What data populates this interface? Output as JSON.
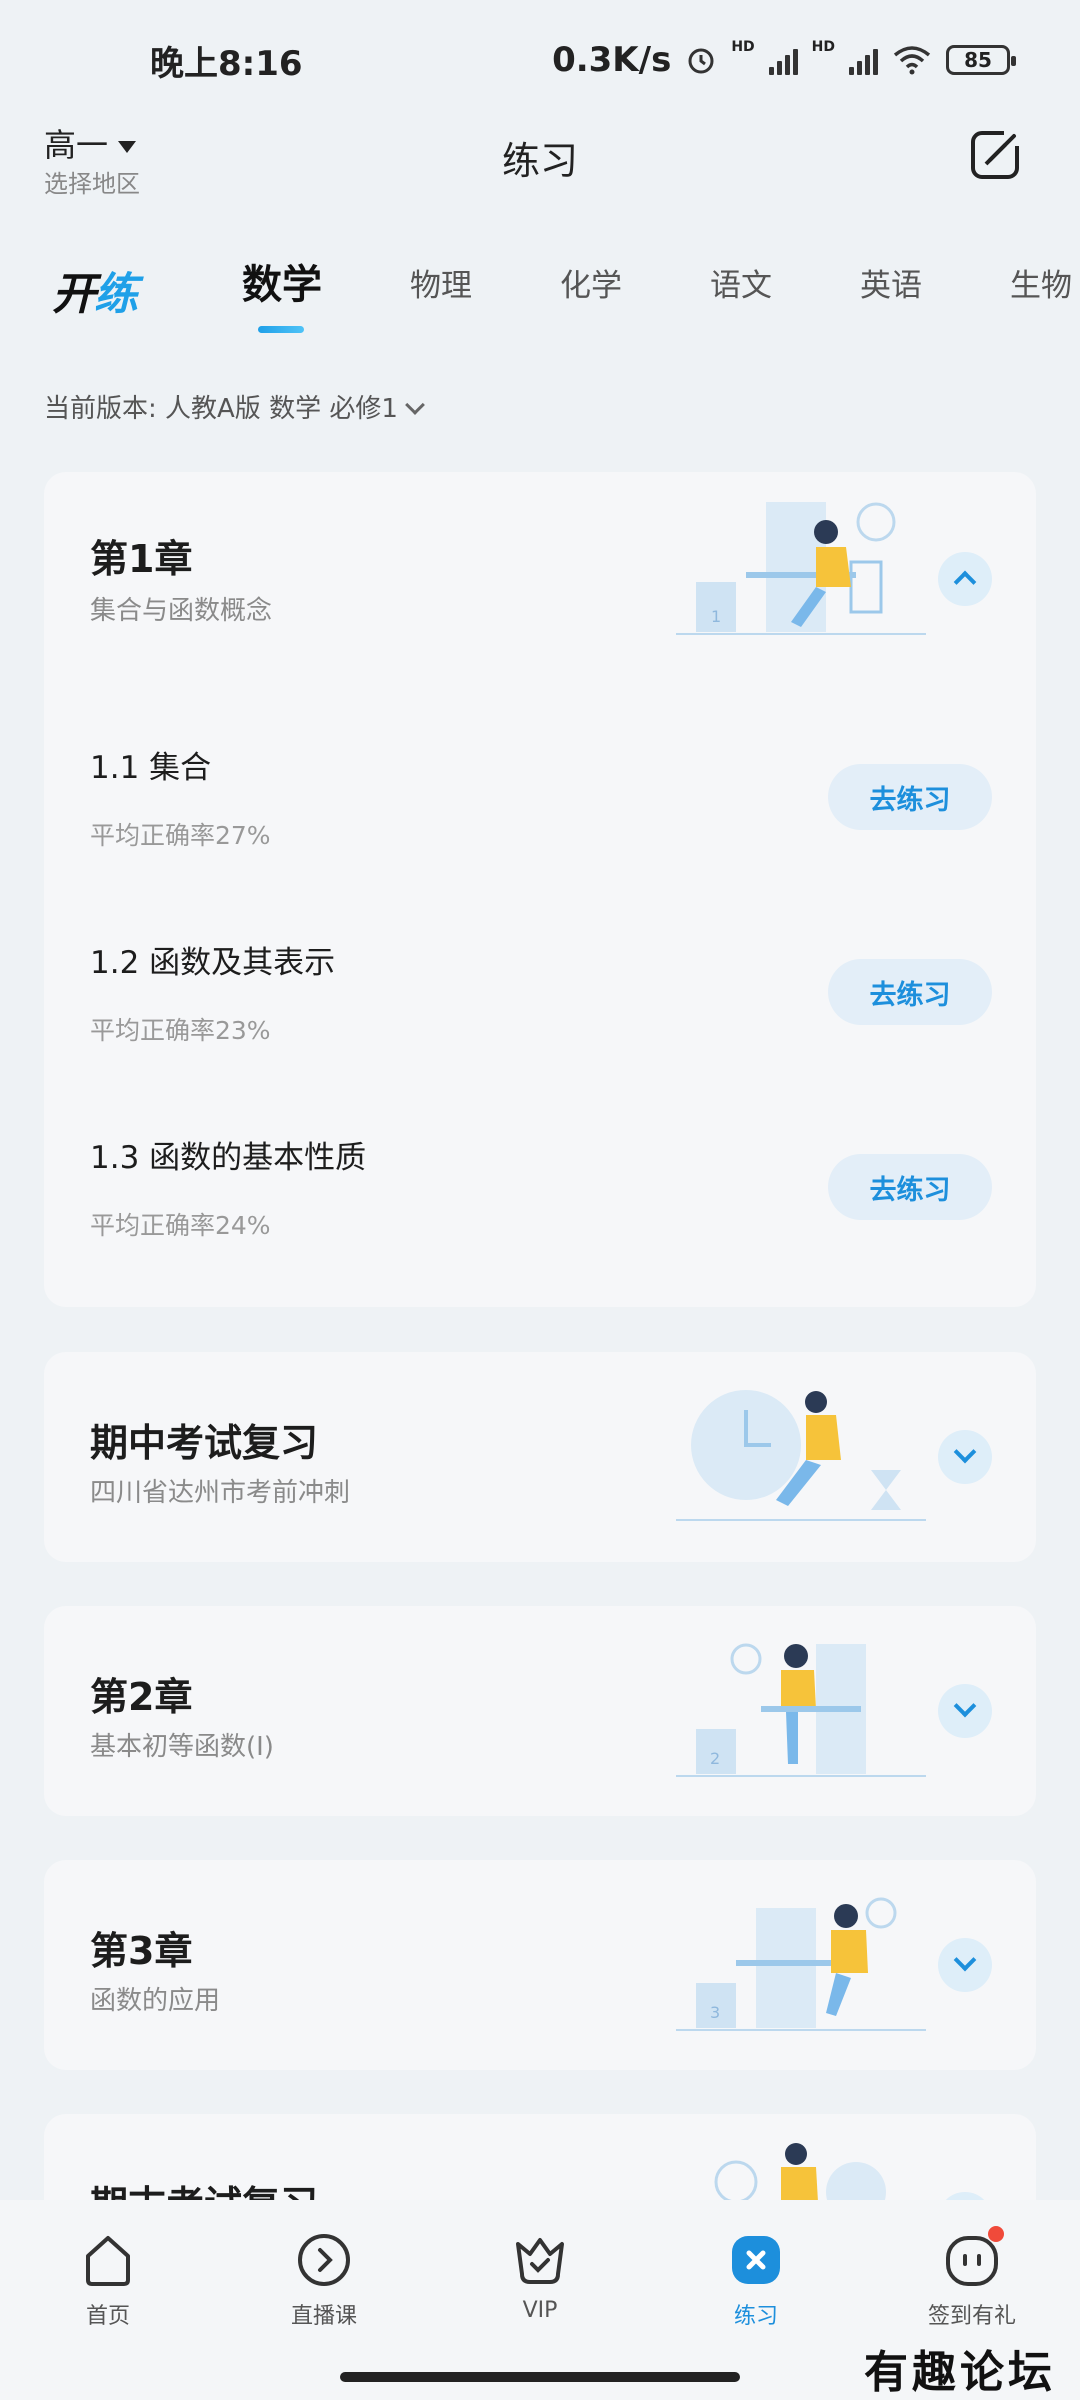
{
  "status_bar": {
    "time": "晚上8:16",
    "net_speed": "0.3K/s",
    "battery": "85"
  },
  "header": {
    "grade": "高一",
    "region": "选择地区",
    "title": "练习"
  },
  "logo_text": "开练",
  "tabs": [
    {
      "label": "数学",
      "active": true
    },
    {
      "label": "物理"
    },
    {
      "label": "化学"
    },
    {
      "label": "语文"
    },
    {
      "label": "英语"
    },
    {
      "label": "生物"
    }
  ],
  "version": "当前版本: 人教A版 数学 必修1",
  "chapters": [
    {
      "title": "第1章",
      "subtitle": "集合与函数概念",
      "expanded": true,
      "sections": [
        {
          "name": "1.1 集合",
          "rate": "平均正确率27%",
          "button": "去练习"
        },
        {
          "name": "1.2 函数及其表示",
          "rate": "平均正确率23%",
          "button": "去练习"
        },
        {
          "name": "1.3 函数的基本性质",
          "rate": "平均正确率24%",
          "button": "去练习"
        }
      ]
    },
    {
      "title": "期中考试复习",
      "subtitle": "四川省达州市考前冲刺",
      "expanded": false
    },
    {
      "title": "第2章",
      "subtitle": "基本初等函数(Ⅰ)",
      "expanded": false
    },
    {
      "title": "第3章",
      "subtitle": "函数的应用",
      "expanded": false
    },
    {
      "title": "期末考试复习",
      "subtitle": "",
      "expanded": false
    }
  ],
  "bottom_nav": [
    {
      "label": "首页",
      "icon": "home-icon"
    },
    {
      "label": "直播课",
      "icon": "play-circle-icon"
    },
    {
      "label": "VIP",
      "icon": "vip-crown-icon"
    },
    {
      "label": "练习",
      "icon": "practice-icon",
      "active": true
    },
    {
      "label": "签到有礼",
      "icon": "checkin-face-icon",
      "badge": true
    }
  ],
  "watermark": "有趣论坛",
  "colors": {
    "accent": "#1d8fdc",
    "badge": "#f04a3a"
  }
}
